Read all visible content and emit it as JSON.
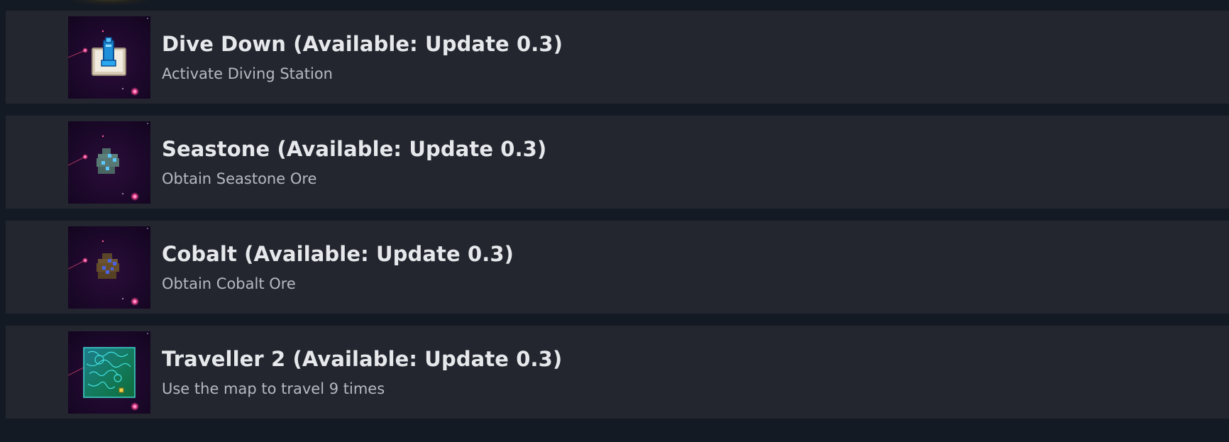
{
  "achievements": [
    {
      "title": "Dive Down (Available: Update 0.3)",
      "description": "Activate Diving Station",
      "icon": "diving-station-icon"
    },
    {
      "title": "Seastone (Available: Update 0.3)",
      "description": "Obtain Seastone Ore",
      "icon": "seastone-ore-icon"
    },
    {
      "title": "Cobalt (Available: Update 0.3)",
      "description": "Obtain Cobalt Ore",
      "icon": "cobalt-ore-icon"
    },
    {
      "title": "Traveller 2 (Available: Update 0.3)",
      "description": "Use the map to travel 9 times",
      "icon": "map-icon"
    }
  ],
  "colors": {
    "page_background": "#141a23",
    "row_background": "#23262f",
    "title_text": "#e6e8eb",
    "description_text": "#b5b9c0",
    "icon_background": "#170828"
  }
}
